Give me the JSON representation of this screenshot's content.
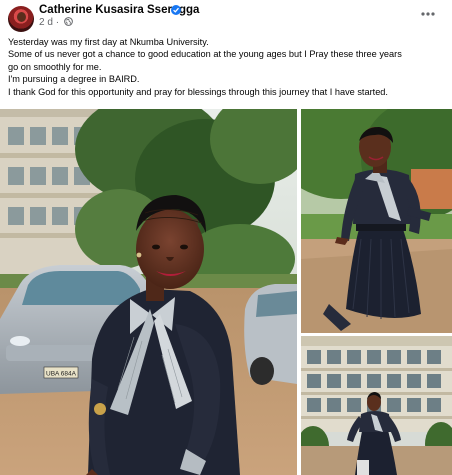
{
  "post": {
    "author": "Catherine Kusasira Sserugga",
    "time": "2 d",
    "dot": "·",
    "paragraphs": [
      "Yesterday was my first day at Nkumba University.",
      "Some of us never got a chance to good education at the young ages but I Pray these three years",
      "go on smoothly for me.",
      "I'm pursuing a degree in BAIRD.",
      "I thank God for this opportunity and pray for blessings through this journey that I have started."
    ]
  },
  "photos": {
    "main_plate": "UBA 684A",
    "icons": [
      "verified-badge-icon",
      "globe-icon",
      "more-options-icon"
    ]
  },
  "colors": {
    "verified": "#1877f2",
    "meta_text": "#65676b",
    "text": "#050505"
  }
}
